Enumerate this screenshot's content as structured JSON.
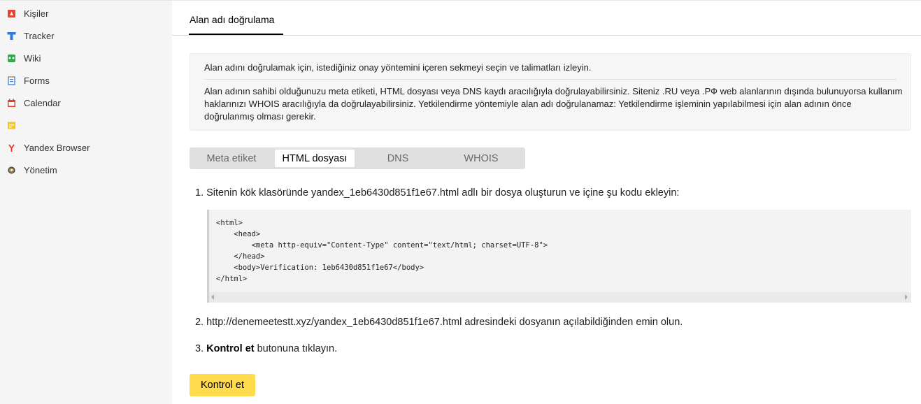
{
  "sidebar": {
    "items": [
      {
        "label": "Kişiler",
        "icon": "contacts-icon"
      },
      {
        "label": "Tracker",
        "icon": "tracker-icon"
      },
      {
        "label": "Wiki",
        "icon": "wiki-icon"
      },
      {
        "label": "Forms",
        "icon": "forms-icon"
      },
      {
        "label": "Calendar",
        "icon": "calendar-icon"
      },
      {
        "label": "",
        "icon": "notes-icon"
      },
      {
        "label": "Yandex Browser",
        "icon": "yandex-browser-icon"
      },
      {
        "label": "Yönetim",
        "icon": "settings-gear-icon"
      }
    ]
  },
  "header": {
    "tab": "Alan adı doğrulama"
  },
  "info": {
    "line1": "Alan adını doğrulamak için, istediğiniz onay yöntemini içeren sekmeyi seçin ve talimatları izleyin.",
    "line2": "Alan adının sahibi olduğunuzu meta etiketi, HTML dosyası veya DNS kaydı aracılığıyla doğrulayabilirsiniz. Siteniz .RU veya .РФ web alanlarının dışında bulunuyorsa kullanım haklarınızı WHOIS aracılığıyla da doğrulayabilirsiniz. Yetkilendirme yöntemiyle alan adı doğrulanamaz: Yetkilendirme işleminin yapılabilmesi için alan adının önce doğrulanmış olması gerekir."
  },
  "tabs": [
    {
      "label": "Meta etiket",
      "active": false
    },
    {
      "label": "HTML dosyası",
      "active": true
    },
    {
      "label": "DNS",
      "active": false
    },
    {
      "label": "WHOIS",
      "active": false
    }
  ],
  "steps": {
    "step1": "1. Sitenin kök klasöründe yandex_1eb6430d851f1e67.html adlı bir dosya oluşturun ve içine şu kodu ekleyin:",
    "code": "<html>\n    <head>\n        <meta http-equiv=\"Content-Type\" content=\"text/html; charset=UTF-8\">\n    </head>\n    <body>Verification: 1eb6430d851f1e67</body>\n</html>",
    "step2": "2. http://denemeetestt.xyz/yandex_1eb6430d851f1e67.html adresindeki dosyanın açılabildiğinden emin olun.",
    "step3_prefix": "3. ",
    "step3_bold": "Kontrol et",
    "step3_suffix": " butonuna tıklayın."
  },
  "button": {
    "label": "Kontrol et"
  },
  "colors": {
    "accent_button": "#ffdb4d",
    "sidebar_bg": "#f5f5f5"
  }
}
